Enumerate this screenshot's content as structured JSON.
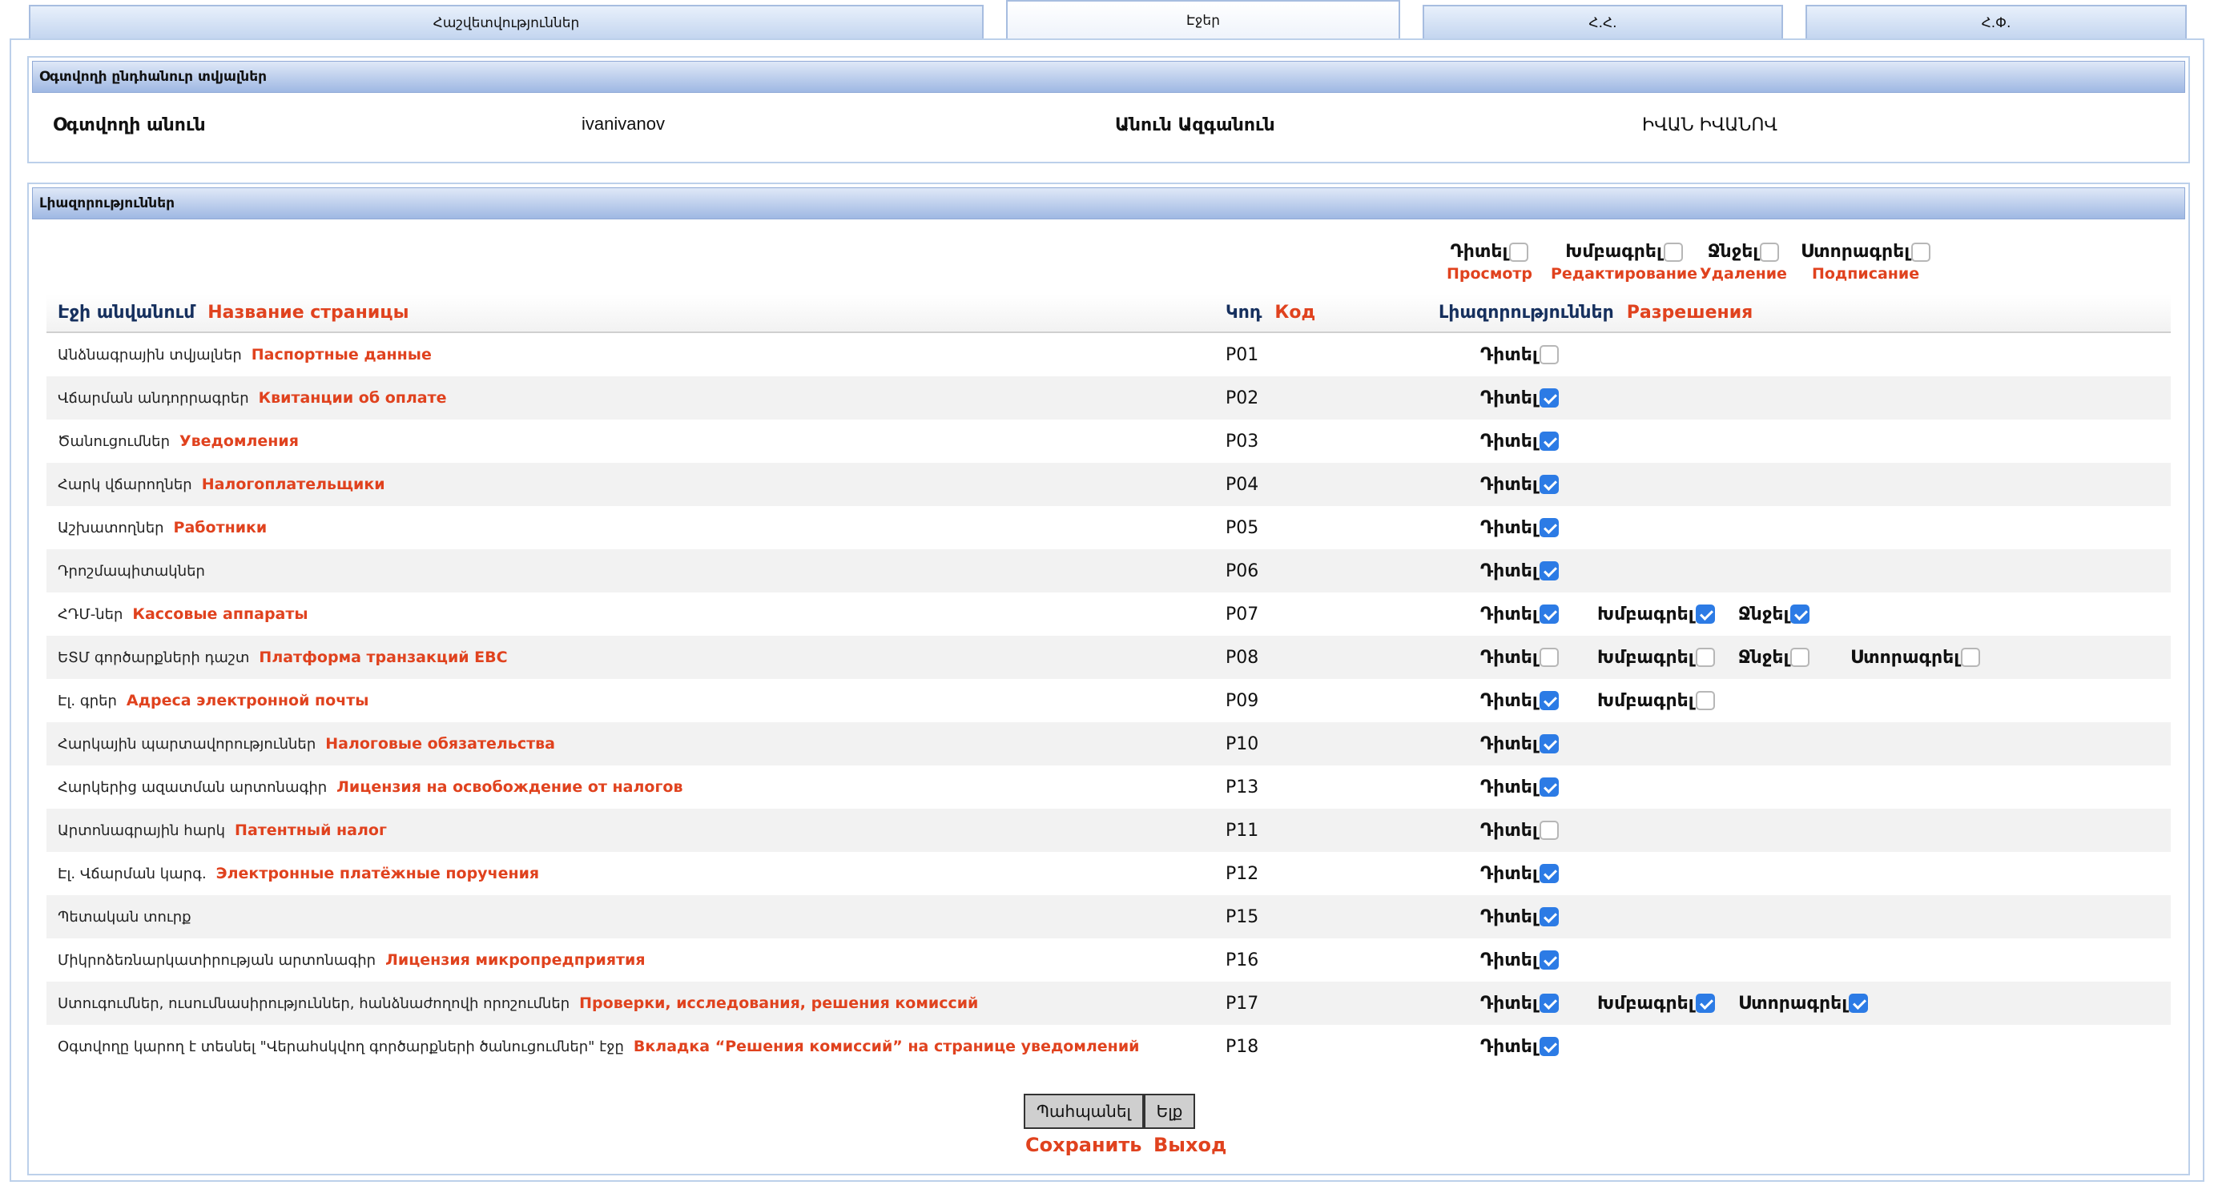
{
  "tabs": [
    {
      "label": "Հաշվետվություններ"
    },
    {
      "label": "Էջեր"
    },
    {
      "label": "Հ.Հ."
    },
    {
      "label": "Հ.Փ."
    }
  ],
  "user_panel": {
    "title": "Օգտվողի ընդհանուր տվյալներ",
    "username_label": "Օգտվողի անուն",
    "username_value": "ivanivanov",
    "fullname_label": "Անուն Ազգանուն",
    "fullname_value": "ԻՎԱՆ ԻՎԱՆՈՎ"
  },
  "permissions_panel": {
    "title": "Լիազորություններ",
    "legend": [
      {
        "label": "Դիտել",
        "ru": "Просмотр",
        "checked": false
      },
      {
        "label": "Խմբագրել",
        "ru": "Редактирование",
        "checked": false
      },
      {
        "label": "Ջնջել",
        "ru": "Удаление",
        "checked": false
      },
      {
        "label": "Ստորագրել",
        "ru": "Подписание",
        "checked": false
      }
    ],
    "columns": {
      "page_name": "Էջի անվանում",
      "page_name_ru": "Название страницы",
      "code": "Կոդ",
      "code_ru": "Код",
      "permissions": "Լիազորություններ",
      "permissions_ru": "Разрешения"
    },
    "rows": [
      {
        "name": "Անձնագրային տվյալներ",
        "ru": "Паспортные данные",
        "code": "P01",
        "perms": [
          {
            "label": "Դիտել",
            "checked": false
          }
        ]
      },
      {
        "name": "Վճարման անդորրագրեր",
        "ru": "Квитанции об оплате",
        "code": "P02",
        "perms": [
          {
            "label": "Դիտել",
            "checked": true
          }
        ]
      },
      {
        "name": "Ծանուցումներ",
        "ru": "Уведомления",
        "code": "P03",
        "perms": [
          {
            "label": "Դիտել",
            "checked": true
          }
        ]
      },
      {
        "name": "Հարկ վճարողներ",
        "ru": "Налогоплательщики",
        "code": "P04",
        "perms": [
          {
            "label": "Դիտել",
            "checked": true
          }
        ]
      },
      {
        "name": "Աշխատողներ",
        "ru": "Работники",
        "code": "P05",
        "perms": [
          {
            "label": "Դիտել",
            "checked": true
          }
        ]
      },
      {
        "name": "Դրոշմապիտակներ",
        "ru": "",
        "code": "P06",
        "perms": [
          {
            "label": "Դիտել",
            "checked": true
          }
        ]
      },
      {
        "name": "ՀԴՄ-ներ",
        "ru": "Кассовые аппараты",
        "code": "P07",
        "perms": [
          {
            "label": "Դիտել",
            "checked": true
          },
          {
            "label": "Խմբագրել",
            "checked": true
          },
          {
            "label": "Ջնջել",
            "checked": true
          }
        ]
      },
      {
        "name": "ԵՏՄ գործարքների դաշտ",
        "ru": "Платформа транзакций ЕВС",
        "code": "P08",
        "perms": [
          {
            "label": "Դիտել",
            "checked": false
          },
          {
            "label": "Խմբագրել",
            "checked": false
          },
          {
            "label": "Ջնջել",
            "checked": false
          },
          {
            "label": "Ստորագրել",
            "checked": false
          }
        ]
      },
      {
        "name": "Էլ. գրեր",
        "ru": "Адреса электронной почты",
        "code": "P09",
        "perms": [
          {
            "label": "Դիտել",
            "checked": true
          },
          {
            "label": "Խմբագրել",
            "checked": false
          }
        ]
      },
      {
        "name": "Հարկային պարտավորություններ",
        "ru": "Налоговые обязательства",
        "code": "P10",
        "perms": [
          {
            "label": "Դիտել",
            "checked": true
          }
        ]
      },
      {
        "name": "Հարկերից ազատման արտոնագիր",
        "ru": "Лицензия на освобождение от налогов",
        "code": "P13",
        "perms": [
          {
            "label": "Դիտել",
            "checked": true
          }
        ]
      },
      {
        "name": "Արտոնագրային հարկ",
        "ru": "Патентный налог",
        "code": "P11",
        "perms": [
          {
            "label": "Դիտել",
            "checked": false
          }
        ]
      },
      {
        "name": "Էլ. Վճարման կարգ.",
        "ru": "Электронные платёжные поручения",
        "code": "P12",
        "perms": [
          {
            "label": "Դիտել",
            "checked": true
          }
        ]
      },
      {
        "name": "Պետական տուրք",
        "ru": "",
        "code": "P15",
        "perms": [
          {
            "label": "Դիտել",
            "checked": true
          }
        ]
      },
      {
        "name": "Միկրոձեռնարկատիրության արտոնագիր",
        "ru": "Лицензия микропредприятия",
        "code": "P16",
        "perms": [
          {
            "label": "Դիտել",
            "checked": true
          }
        ]
      },
      {
        "name": "Ստուգումներ, ուսումնասիրություններ, հանձնաժողովի որոշումներ",
        "ru": "Проверки, исследования, решения комиссий",
        "code": "P17",
        "perms": [
          {
            "label": "Դիտել",
            "checked": true
          },
          {
            "label": "Խմբագրել",
            "checked": true
          },
          {
            "label": "Ստորագրել",
            "checked": true
          }
        ]
      },
      {
        "name": "Օգտվողը կարող է տեսնել \"Վերահսկվող գործարքների ծանուցումներ\" էջը",
        "ru": "Вкладка “Решения комиссий” на странице уведомлений",
        "code": "P18",
        "perms": [
          {
            "label": "Դիտել",
            "checked": true
          }
        ]
      }
    ]
  },
  "buttons": {
    "save": "Պահպանել",
    "save_ru": "Сохранить",
    "exit": "Ելք",
    "exit_ru": "Выход"
  },
  "colors": {
    "accent_ru": "#e0421e",
    "checkbox": "#2c7be5",
    "header_blue": "#9fb8e3"
  }
}
